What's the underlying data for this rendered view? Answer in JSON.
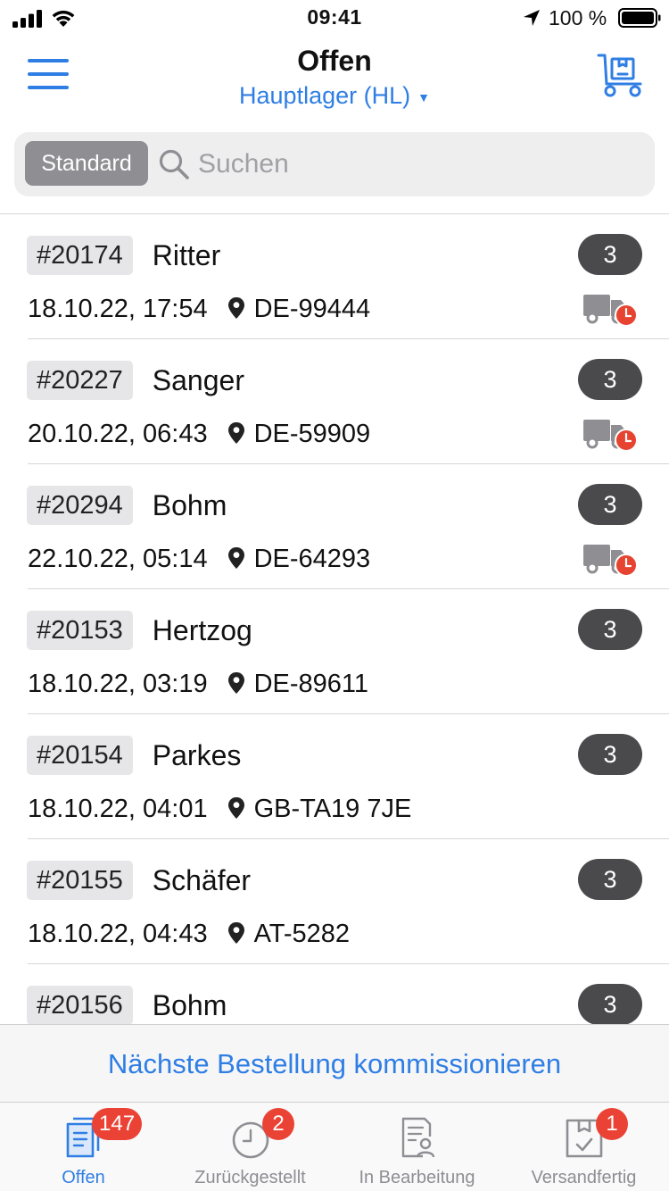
{
  "status_bar": {
    "time": "09:41",
    "battery": "100 %"
  },
  "header": {
    "title": "Offen",
    "warehouse": "Hauptlager (HL)",
    "menu_icon": "hamburger-menu-icon",
    "cart_icon": "picking-cart-icon"
  },
  "search": {
    "scope": "Standard",
    "placeholder": "Suchen"
  },
  "orders": [
    {
      "id": "#20174",
      "name": "Ritter",
      "date": "18.10.22, 17:54",
      "zip": "DE-99444",
      "qty": "3",
      "delayed": true
    },
    {
      "id": "#20227",
      "name": "Sanger",
      "date": "20.10.22, 06:43",
      "zip": "DE-59909",
      "qty": "3",
      "delayed": true
    },
    {
      "id": "#20294",
      "name": "Bohm",
      "date": "22.10.22, 05:14",
      "zip": "DE-64293",
      "qty": "3",
      "delayed": true
    },
    {
      "id": "#20153",
      "name": "Hertzog",
      "date": "18.10.22, 03:19",
      "zip": "DE-89611",
      "qty": "3",
      "delayed": false
    },
    {
      "id": "#20154",
      "name": "Parkes",
      "date": "18.10.22, 04:01",
      "zip": "GB-TA19 7JE",
      "qty": "3",
      "delayed": false
    },
    {
      "id": "#20155",
      "name": "Schäfer",
      "date": "18.10.22, 04:43",
      "zip": "AT-5282",
      "qty": "3",
      "delayed": false
    },
    {
      "id": "#20156",
      "name": "Bohm",
      "date": "",
      "zip": "",
      "qty": "3",
      "delayed": false
    }
  ],
  "bottom_action": {
    "label": "Nächste Bestellung kommissionieren"
  },
  "tabs": [
    {
      "label": "Offen",
      "badge": "147",
      "icon": "open-orders-icon",
      "active": true
    },
    {
      "label": "Zurückgestellt",
      "badge": "2",
      "icon": "clock-icon",
      "active": false
    },
    {
      "label": "In Bearbeitung",
      "badge": "",
      "icon": "user-document-icon",
      "active": false
    },
    {
      "label": "Versandfertig",
      "badge": "1",
      "icon": "package-check-icon",
      "active": false
    }
  ],
  "colors": {
    "accent": "#2f7ee4",
    "badge_red": "#ea4335",
    "qty_badge": "#4a4a4c",
    "delay_red": "#e64331",
    "truck_grey": "#8e8e93"
  }
}
